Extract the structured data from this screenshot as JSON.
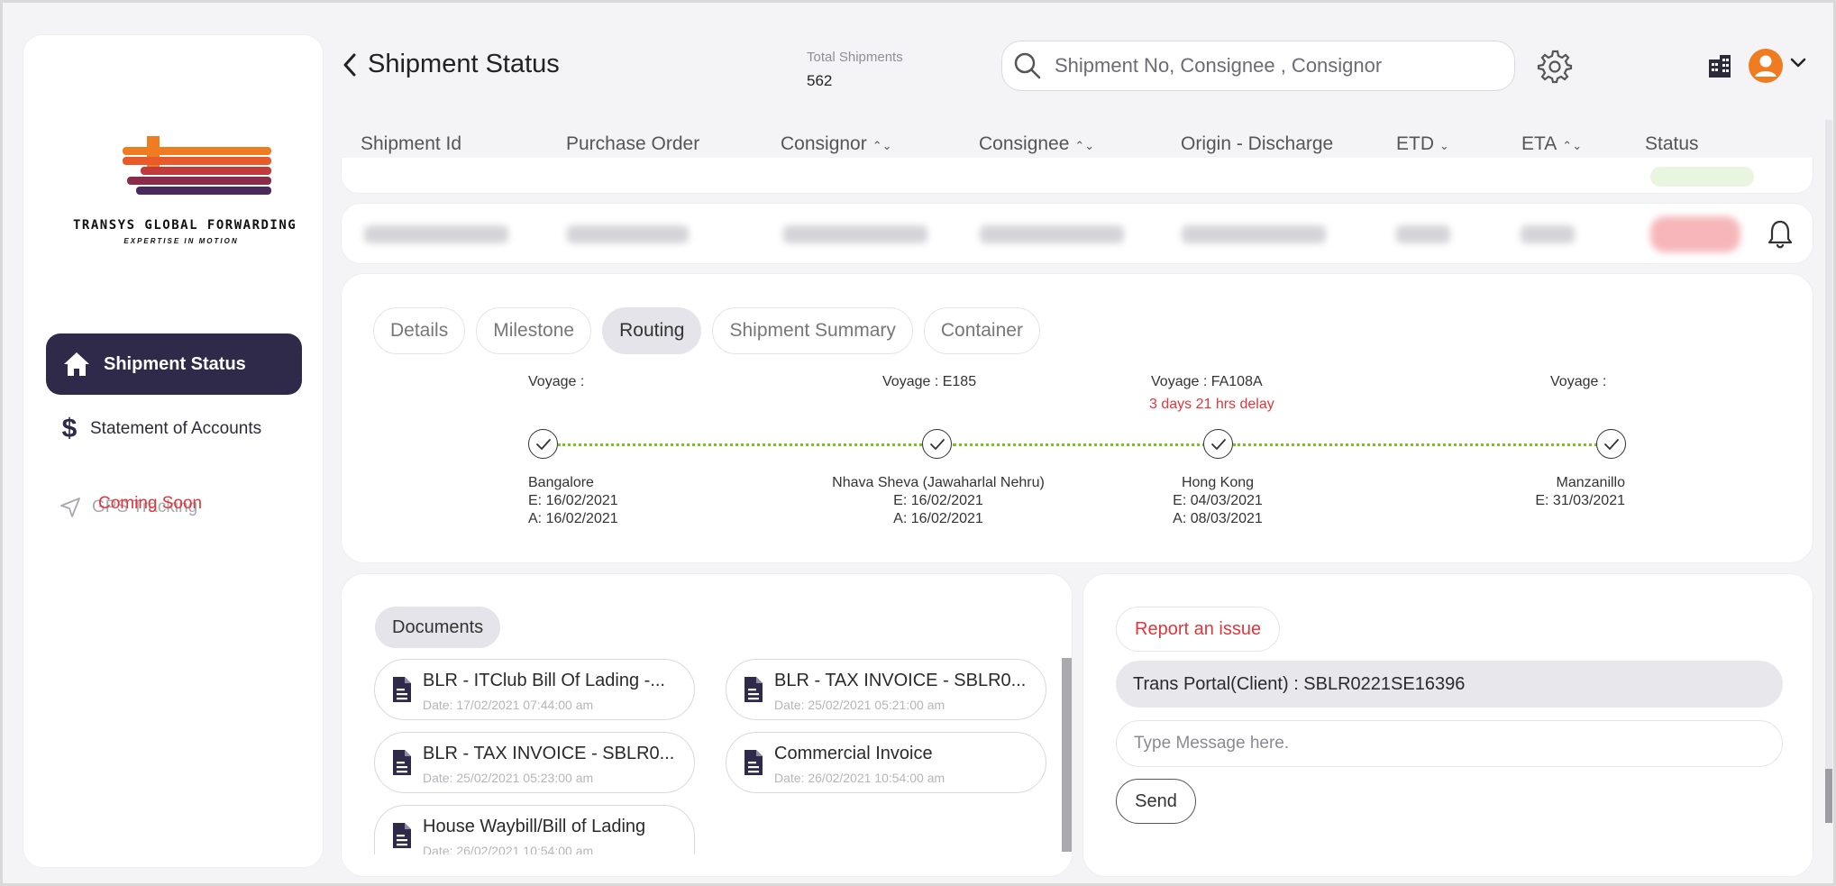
{
  "app": {
    "brand_name": "TRANSYS GLOBAL FORWARDING",
    "brand_tagline": "EXPERTISE IN MOTION"
  },
  "sidebar": {
    "items": [
      {
        "label": "Shipment Status",
        "icon": "home-icon"
      },
      {
        "label": "Statement of Accounts",
        "icon": "dollar-icon"
      },
      {
        "label": "GPS Tracking",
        "icon": "navigation-arrow-icon",
        "note": "Coming Soon"
      }
    ]
  },
  "header": {
    "title": "Shipment Status",
    "total_label": "Total Shipments",
    "total_value": "562",
    "search_placeholder": "Shipment No, Consignee , Consignor"
  },
  "table": {
    "columns": [
      "Shipment Id",
      "Purchase Order",
      "Consignor",
      "Consignee",
      "Origin - Discharge",
      "ETD",
      "ETA",
      "Status"
    ]
  },
  "tabs": [
    "Details",
    "Milestone",
    "Routing",
    "Shipment Summary",
    "Container"
  ],
  "active_tab": "Routing",
  "routing": {
    "stops": [
      {
        "voyage": "Voyage :",
        "delay": "",
        "name": "Bangalore",
        "estimated": "E: 16/02/2021",
        "actual": "A: 16/02/2021"
      },
      {
        "voyage": "Voyage :  E185",
        "delay": "",
        "name": "Nhava Sheva (Jawaharlal Nehru)",
        "estimated": "E: 16/02/2021",
        "actual": "A: 16/02/2021"
      },
      {
        "voyage": "Voyage :  FA108A",
        "delay": "3 days 21 hrs delay",
        "name": "Hong Kong",
        "estimated": "E: 04/03/2021",
        "actual": "A: 08/03/2021"
      },
      {
        "voyage": "Voyage :",
        "delay": "",
        "name": "Manzanillo",
        "estimated": "E: 31/03/2021",
        "actual": ""
      }
    ],
    "line_color": "#7ac21e",
    "delay_color": "#e0363c"
  },
  "documents": {
    "label": "Documents",
    "items": [
      {
        "name": "BLR - ITClub Bill Of Lading -...",
        "date": "Date: 17/02/2021 07:44:00 am"
      },
      {
        "name": "BLR - TAX INVOICE - SBLR0...",
        "date": "Date: 25/02/2021 05:21:00 am"
      },
      {
        "name": "BLR - TAX INVOICE - SBLR0...",
        "date": "Date: 25/02/2021 05:23:00 am"
      },
      {
        "name": "Commercial Invoice",
        "date": "Date: 26/02/2021 10:54:00 am"
      },
      {
        "name": "House Waybill/Bill of Lading",
        "date": "Date: 26/02/2021 10:54:00 am"
      }
    ]
  },
  "issue": {
    "report_label": "Report an issue",
    "portal_text": "Trans Portal(Client) : SBLR0221SE16396",
    "message_placeholder": "Type Message here.",
    "send_label": "Send"
  },
  "colors": {
    "primary": "#2f2a4a",
    "accent_orange": "#f07c22",
    "danger": "#e0363c"
  }
}
